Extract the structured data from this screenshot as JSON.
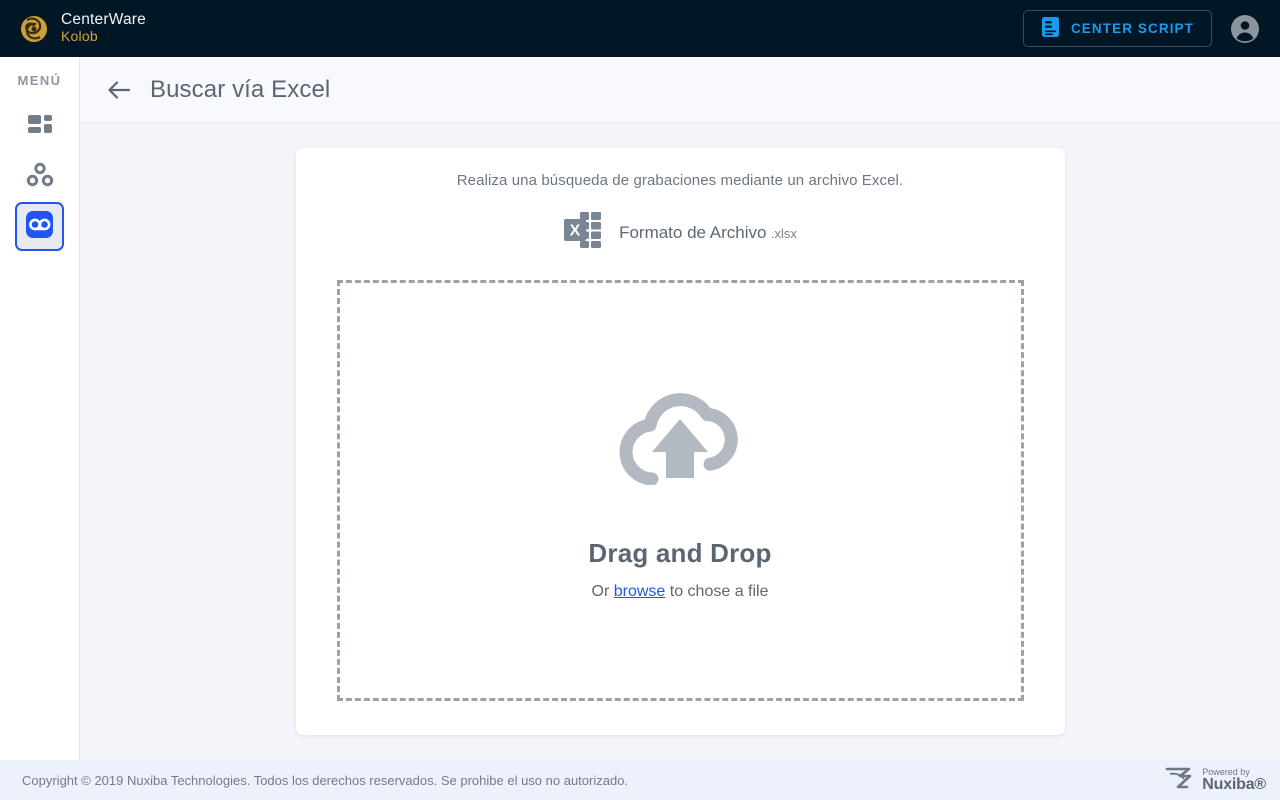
{
  "header": {
    "brand_title": "CenterWare",
    "brand_sub": "Kolob",
    "brand_icon": "centerware-swirl-logo",
    "script_button_label": "CENTER SCRIPT",
    "script_button_icon": "script-document-icon",
    "account_icon": "account-circle-icon",
    "colors": {
      "background": "#021726",
      "accent": "#1a9bf0",
      "brand_gold": "#d8a43a"
    }
  },
  "sidebar": {
    "label": "MENÚ",
    "items": [
      {
        "name": "dashboard",
        "icon": "dashboard-grid-icon",
        "active": false
      },
      {
        "name": "campaigns",
        "icon": "group-circles-icon",
        "active": false
      },
      {
        "name": "recordings",
        "icon": "voicemail-icon",
        "active": true
      }
    ],
    "active_color": "#1f56f0"
  },
  "subheader": {
    "back_icon": "back-arrow-icon",
    "title": "Buscar vía Excel"
  },
  "main": {
    "intro": "Realiza una búsqueda de grabaciones mediante un archivo Excel.",
    "format": {
      "icon": "excel-file-icon",
      "title": "Formato de Archivo",
      "extension": ".xlsx"
    },
    "dropzone": {
      "icon": "cloud-upload-icon",
      "title": "Drag and Drop",
      "sub_prefix": "Or ",
      "browse_label": "browse",
      "sub_suffix": " to chose a file"
    }
  },
  "footer": {
    "copyright": "Copyright © 2019 Nuxiba Technologies. Todos los derechos reservados. Se prohibe el uso no autorizado.",
    "powered_small": "Powered by",
    "powered_big": "Nuxiba®",
    "powered_icon": "nuxiba-swoosh-logo"
  }
}
